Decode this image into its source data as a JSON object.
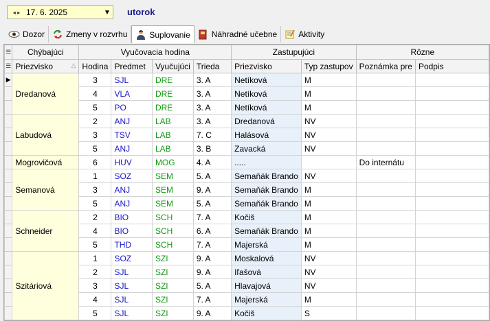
{
  "toolbar": {
    "date": "17. 6. 2025",
    "day": "utorok"
  },
  "tabs": [
    {
      "label": "Dozor",
      "icon": "eye-icon"
    },
    {
      "label": "Zmeny v rozvrhu",
      "icon": "refresh-icon"
    },
    {
      "label": "Suplovanie",
      "icon": "person-icon"
    },
    {
      "label": "Náhradné učebne",
      "icon": "book-icon"
    },
    {
      "label": "Aktivity",
      "icon": "note-icon"
    }
  ],
  "grid": {
    "bands": {
      "absent": "Chýbajúci",
      "lesson": "Vyučovacia hodina",
      "subst": "Zastupujúci",
      "misc": "Rôzne"
    },
    "columns": {
      "absent_name": "Priezvisko",
      "hour": "Hodina",
      "subject": "Predmet",
      "teacher": "Vyučujúci",
      "class": "Trieda",
      "subst_name": "Priezvisko",
      "subst_type": "Typ zastupov",
      "note": "Poznámka pre",
      "sign": "Podpis"
    },
    "groups": [
      {
        "name": "Dredanová",
        "rows": [
          {
            "hour": "3",
            "subject": "SJL",
            "teacher": "DRE",
            "class": "3. A",
            "subst": "Netíková",
            "type": "M",
            "note": ""
          },
          {
            "hour": "4",
            "subject": "VLA",
            "teacher": "DRE",
            "class": "3. A",
            "subst": "Netíková",
            "type": "M",
            "note": ""
          },
          {
            "hour": "5",
            "subject": "PO",
            "teacher": "DRE",
            "class": "3. A",
            "subst": "Netíková",
            "type": "M",
            "note": ""
          }
        ]
      },
      {
        "name": "Labudová",
        "rows": [
          {
            "hour": "2",
            "subject": "ANJ",
            "teacher": "LAB",
            "class": "3. A",
            "subst": "Dredanová",
            "type": "NV",
            "note": ""
          },
          {
            "hour": "3",
            "subject": "TSV",
            "teacher": "LAB",
            "class": "7. C",
            "subst": "Halásová",
            "type": "NV",
            "note": ""
          },
          {
            "hour": "5",
            "subject": "ANJ",
            "teacher": "LAB",
            "class": "3. B",
            "subst": "Zavacká",
            "type": "NV",
            "note": ""
          }
        ]
      },
      {
        "name": "Mogrovičová",
        "rows": [
          {
            "hour": "6",
            "subject": "HUV",
            "teacher": "MOG",
            "class": "4. A",
            "subst": ".....",
            "type": "",
            "note": "Do internátu"
          }
        ]
      },
      {
        "name": "Semanová",
        "rows": [
          {
            "hour": "1",
            "subject": "SOZ",
            "teacher": "SEM",
            "class": "5. A",
            "subst": "Semaňák Brando",
            "type": "NV",
            "note": ""
          },
          {
            "hour": "3",
            "subject": "ANJ",
            "teacher": "SEM",
            "class": "9. A",
            "subst": "Semaňák Brando",
            "type": "M",
            "note": ""
          },
          {
            "hour": "5",
            "subject": "ANJ",
            "teacher": "SEM",
            "class": "5. A",
            "subst": "Semaňák Brando",
            "type": "M",
            "note": ""
          }
        ]
      },
      {
        "name": "Schneider",
        "rows": [
          {
            "hour": "2",
            "subject": "BIO",
            "teacher": "SCH",
            "class": "7. A",
            "subst": "Kočiš",
            "type": "M",
            "note": ""
          },
          {
            "hour": "4",
            "subject": "BIO",
            "teacher": "SCH",
            "class": "6. A",
            "subst": "Semaňák Brando",
            "type": "M",
            "note": ""
          },
          {
            "hour": "5",
            "subject": "THD",
            "teacher": "SCH",
            "class": "7. A",
            "subst": "Majerská",
            "type": "M",
            "note": ""
          }
        ]
      },
      {
        "name": "Szitáriová",
        "rows": [
          {
            "hour": "1",
            "subject": "SOZ",
            "teacher": "SZI",
            "class": "9. A",
            "subst": "Moskalová",
            "type": "NV",
            "note": ""
          },
          {
            "hour": "2",
            "subject": "SJL",
            "teacher": "SZI",
            "class": "9. A",
            "subst": "Iľašová",
            "type": "NV",
            "note": ""
          },
          {
            "hour": "3",
            "subject": "SJL",
            "teacher": "SZI",
            "class": "5. A",
            "subst": "Hlavajová",
            "type": "NV",
            "note": ""
          },
          {
            "hour": "4",
            "subject": "SJL",
            "teacher": "SZI",
            "class": "7. A",
            "subst": "Majerská",
            "type": "M",
            "note": ""
          },
          {
            "hour": "5",
            "subject": "SJL",
            "teacher": "SZI",
            "class": "9. A",
            "subst": "Kočiš",
            "type": "S",
            "note": ""
          }
        ]
      }
    ]
  }
}
